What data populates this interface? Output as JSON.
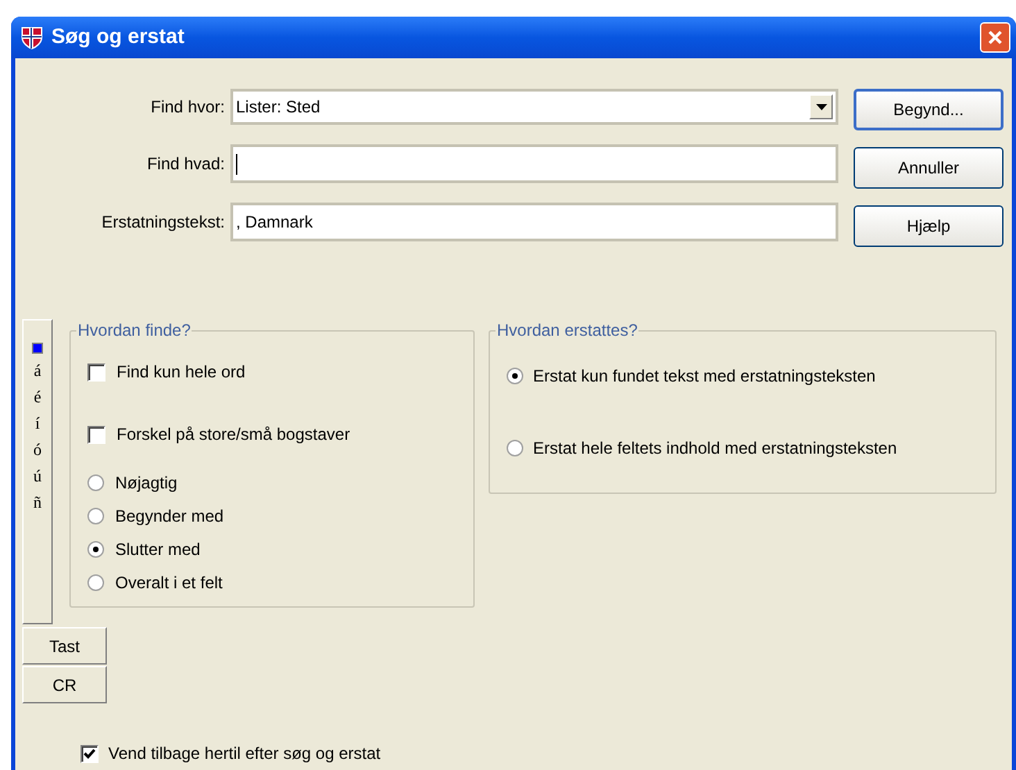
{
  "window": {
    "title": "Søg og erstat"
  },
  "fields": [
    {
      "label": "Find hvor:",
      "kind": "dropdown",
      "value": "Lister: Sted"
    },
    {
      "label": "Find hvad:",
      "kind": "text",
      "focused": true
    },
    {
      "label": "Erstatningstekst:",
      "kind": "text",
      "value": ", Damnark",
      "focused": false
    }
  ],
  "buttons": [
    {
      "label": "Begynd...",
      "default": true
    },
    {
      "label": "Annuller",
      "default": false
    },
    {
      "label": "Hjælp",
      "default": false
    }
  ],
  "char_strip": [
    {
      "kind": "swatch",
      "color": "#0000ff"
    },
    {
      "kind": "char",
      "text": "á"
    },
    {
      "kind": "char",
      "text": "é"
    },
    {
      "kind": "char",
      "text": "í"
    },
    {
      "kind": "char",
      "text": "ó"
    },
    {
      "kind": "char",
      "text": "ú"
    },
    {
      "kind": "char",
      "text": "ñ"
    }
  ],
  "side_buttons": [
    "Tast",
    "CR"
  ],
  "find_group": {
    "title": "Hvordan finde?",
    "options": [
      {
        "kind": "checkbox",
        "label": "Find kun hele ord",
        "checked": false
      },
      {
        "kind": "checkbox",
        "label": "Forskel på store/små bogstaver",
        "checked": false
      },
      {
        "kind": "radio",
        "label": "Nøjagtig",
        "selected": false
      },
      {
        "kind": "radio",
        "label": "Begynder med",
        "selected": false
      },
      {
        "kind": "radio",
        "label": "Slutter med",
        "selected": true
      },
      {
        "kind": "radio",
        "label": "Overalt i et felt",
        "selected": false
      }
    ]
  },
  "replace_group": {
    "title": "Hvordan erstattes?",
    "options": [
      {
        "label": "Erstat kun fundet tekst med erstatningsteksten",
        "selected": true
      },
      {
        "label": "Erstat hele feltets indhold med erstatningsteksten",
        "selected": false
      }
    ]
  },
  "return_checkbox": {
    "label": "Vend tilbage hertil efter søg og erstat",
    "checked": true
  }
}
